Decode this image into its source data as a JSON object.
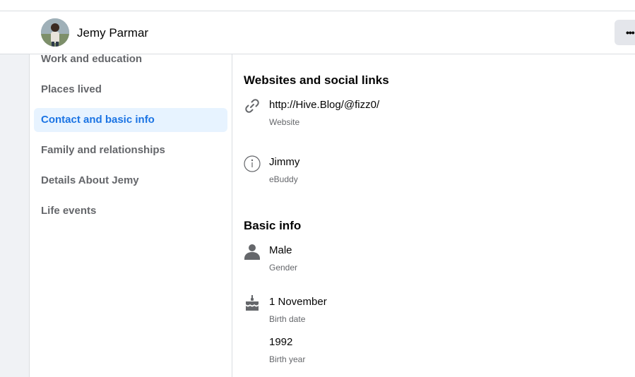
{
  "profile": {
    "name": "Jemy Parmar",
    "more_label": "•••"
  },
  "sidebar": {
    "items": [
      {
        "label": "Work and education",
        "active": false
      },
      {
        "label": "Places lived",
        "active": false
      },
      {
        "label": "Contact and basic info",
        "active": true
      },
      {
        "label": "Family and relationships",
        "active": false
      },
      {
        "label": "Details About Jemy",
        "active": false
      },
      {
        "label": "Life events",
        "active": false
      }
    ]
  },
  "websites": {
    "title": "Websites and social links",
    "items": [
      {
        "icon": "link-icon",
        "value": "http://Hive.Blog/@fizz0/",
        "label": "Website"
      },
      {
        "icon": "info-icon",
        "value": "Jimmy",
        "label": "eBuddy"
      }
    ]
  },
  "basic_info": {
    "title": "Basic info",
    "items": [
      {
        "icon": "person-icon",
        "value": "Male",
        "label": "Gender"
      },
      {
        "icon": "birthday-cake-icon",
        "value": "1 November",
        "label": "Birth date"
      },
      {
        "icon": "",
        "value": "1992",
        "label": "Birth year"
      }
    ]
  },
  "colors": {
    "accent": "#1b74e4",
    "active_bg": "#e7f3ff",
    "secondary_text": "#65676b",
    "icon_gray": "#65676b"
  }
}
